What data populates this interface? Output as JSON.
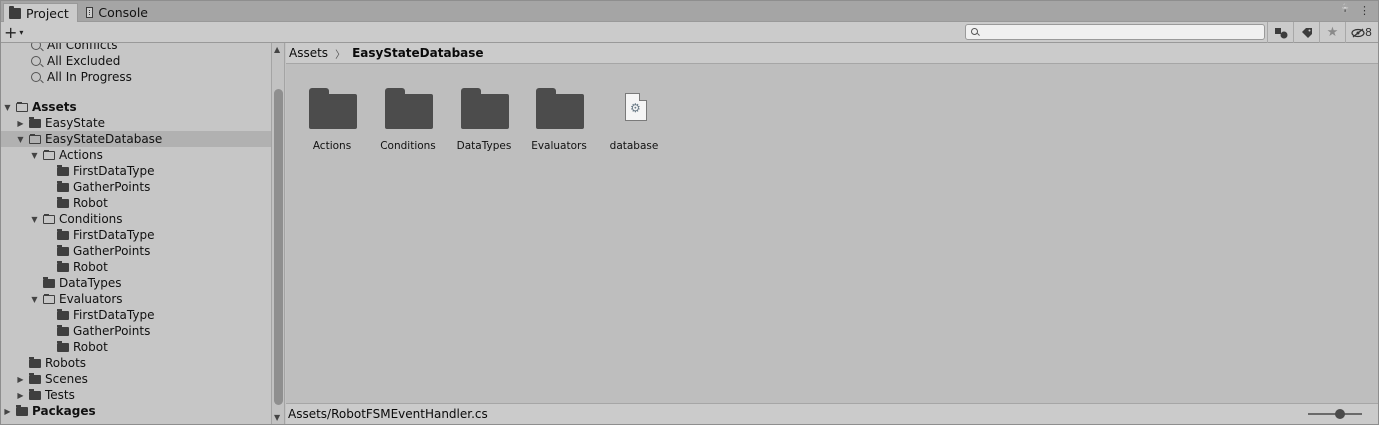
{
  "tabs": [
    {
      "label": "Project",
      "icon": "folder-icon",
      "active": true
    },
    {
      "label": "Console",
      "icon": "console-icon",
      "active": false
    }
  ],
  "tab_tools": {
    "lock": "🔒",
    "menu": "⋮"
  },
  "toolbar": {
    "add_label": "+",
    "add_caret": "▾",
    "search_placeholder": "",
    "filter_type_icon": "type-filter-icon",
    "label_icon": "tag-icon",
    "favorite_icon": "star-icon",
    "hidden_count": "8"
  },
  "tree": {
    "rows": [
      {
        "label": "All Conflicts",
        "kind": "search"
      },
      {
        "label": "All Excluded",
        "kind": "search"
      },
      {
        "label": "All In Progress",
        "kind": "search"
      },
      {
        "label": "",
        "kind": "blank"
      },
      {
        "label": "Assets",
        "kind": "folder",
        "expanded": true
      },
      {
        "label": "EasyState",
        "kind": "folder",
        "expanded": false
      },
      {
        "label": "EasyStateDatabase",
        "kind": "folder",
        "expanded": true,
        "selected": true
      },
      {
        "label": "Actions",
        "kind": "folder",
        "expanded": true
      },
      {
        "label": "FirstDataType",
        "kind": "folder"
      },
      {
        "label": "GatherPoints",
        "kind": "folder"
      },
      {
        "label": "Robot",
        "kind": "folder"
      },
      {
        "label": "Conditions",
        "kind": "folder",
        "expanded": true
      },
      {
        "label": "FirstDataType",
        "kind": "folder"
      },
      {
        "label": "GatherPoints",
        "kind": "folder"
      },
      {
        "label": "Robot",
        "kind": "folder"
      },
      {
        "label": "DataTypes",
        "kind": "folder"
      },
      {
        "label": "Evaluators",
        "kind": "folder",
        "expanded": true
      },
      {
        "label": "FirstDataType",
        "kind": "folder"
      },
      {
        "label": "GatherPoints",
        "kind": "folder"
      },
      {
        "label": "Robot",
        "kind": "folder"
      },
      {
        "label": "Robots",
        "kind": "folder"
      },
      {
        "label": "Scenes",
        "kind": "folder",
        "expanded": false
      },
      {
        "label": "Tests",
        "kind": "folder",
        "expanded": false
      },
      {
        "label": "Packages",
        "kind": "folder",
        "expanded": false
      }
    ]
  },
  "breadcrumb": {
    "root": "Assets",
    "current": "EasyStateDatabase"
  },
  "assets": [
    {
      "label": "Actions",
      "type": "folder"
    },
    {
      "label": "Conditions",
      "type": "folder"
    },
    {
      "label": "DataTypes",
      "type": "folder"
    },
    {
      "label": "Evaluators",
      "type": "folder"
    },
    {
      "label": "database",
      "type": "asset-file"
    }
  ],
  "statusbar": {
    "path": "Assets/RobotFSMEventHandler.cs"
  }
}
